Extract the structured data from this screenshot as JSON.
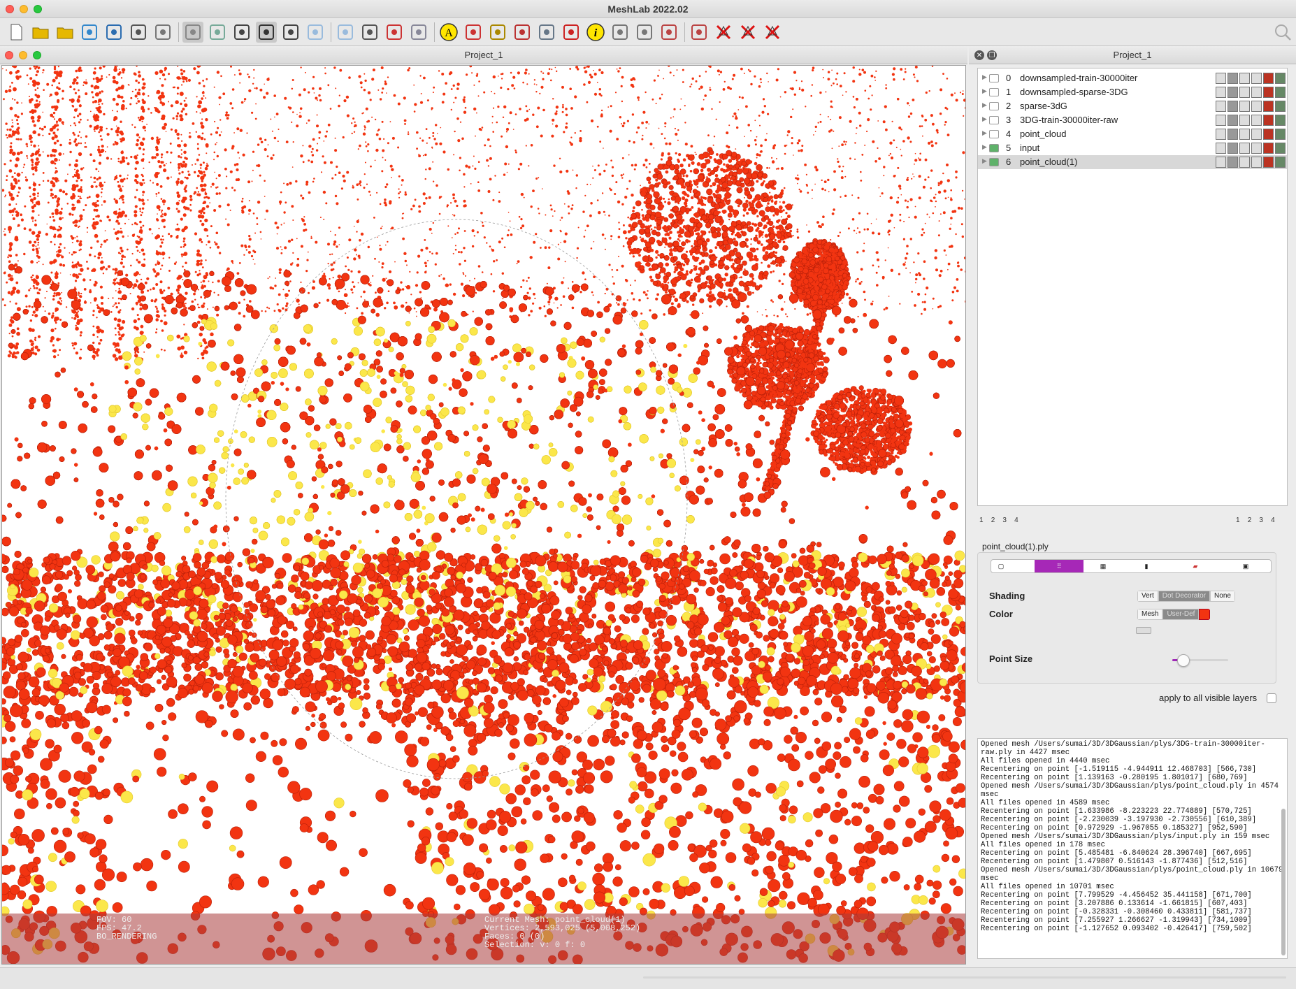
{
  "app": {
    "title": "MeshLab 2022.02"
  },
  "toolbar": {
    "icons": [
      "new-project",
      "open-project",
      "open-mesh",
      "reload",
      "reload-all",
      "save",
      "snapshot",
      "layers",
      "show-grid",
      "bbox",
      "points",
      "wireframe",
      "flat",
      "smooth",
      "box-lines",
      "axis",
      "trackball",
      "annotation",
      "measure",
      "calc",
      "paint",
      "pick",
      "georef",
      "info",
      "select",
      "select-vert",
      "select-face",
      "select-conn",
      "delete-vert",
      "delete-face",
      "delete-selected"
    ]
  },
  "viewport": {
    "window_title": "Project_1",
    "hud_left": [
      "FOV: 60",
      "FPS:   47.2",
      "BO_RENDERING"
    ],
    "hud_right": [
      "Current Mesh: point_cloud(1)",
      "Vertices: 2,593,025     (5,008,252)",
      "Faces: 0     (0)",
      "Selection: v: 0 f: 0"
    ],
    "colors": {
      "red": "#f23411",
      "yellow": "#fbe74a",
      "background": "#ffffff"
    }
  },
  "panel": {
    "title": "Project_1",
    "layers": [
      {
        "num": "0",
        "name": "downsampled-train-30000iter",
        "visible": false
      },
      {
        "num": "1",
        "name": "downsampled-sparse-3DG",
        "visible": false
      },
      {
        "num": "2",
        "name": "sparse-3dG",
        "visible": false
      },
      {
        "num": "3",
        "name": "3DG-train-30000iter-raw",
        "visible": false
      },
      {
        "num": "4",
        "name": "point_cloud",
        "visible": false
      },
      {
        "num": "5",
        "name": "input",
        "visible": true
      },
      {
        "num": "6",
        "name": "point_cloud(1)",
        "visible": true,
        "selected": true
      }
    ],
    "pages_left": [
      "1",
      "2",
      "3",
      "4"
    ],
    "pages_right": [
      "1",
      "2",
      "3",
      "4"
    ],
    "file_label": "point_cloud(1).ply",
    "shading_label": "Shading",
    "shading_options": [
      "Vert",
      "Dot Decorator",
      "None"
    ],
    "color_label": "Color",
    "color_options": [
      "Mesh",
      "User-Def"
    ],
    "point_size_label": "Point Size",
    "point_size_value": 0.2,
    "apply_label": "apply to all visible layers"
  },
  "log": [
    "Opened mesh /Users/sumai/3D/3DGaussian/plys/3DG-train-30000iter-",
    "raw.ply in 4427 msec",
    "All files opened in 4440 msec",
    "Recentering on point [-1.519115 -4.944911 12.468703] [566,730]",
    "Recentering on point [1.139163 -0.280195 1.801017] [680,769]",
    "Opened mesh /Users/sumai/3D/3DGaussian/plys/point_cloud.ply in 4574",
    "msec",
    "All files opened in 4589 msec",
    "Recentering on point [1.633986 -8.223223 22.774889] [570,725]",
    "Recentering on point [-2.230039 -3.197930 -2.730556] [610,389]",
    "Recentering on point [0.972929 -1.967055 0.185327] [952,590]",
    "Opened mesh /Users/sumai/3D/3DGaussian/plys/input.ply in 159 msec",
    "All files opened in 178 msec",
    "Recentering on point [5.485481 -6.840624 28.396740] [667,695]",
    "Recentering on point [1.479807 0.516143 -1.877436] [512,516]",
    "Opened mesh /Users/sumai/3D/3DGaussian/plys/point_cloud.ply in 10679",
    "msec",
    "All files opened in 10701 msec",
    "Recentering on point [7.799529 -4.456452 35.441158] [671,700]",
    "Recentering on point [3.207886 0.133614 -1.661815] [607,403]",
    "Recentering on point [-0.328331 -0.308460 0.433811] [581,737]",
    "Recentering on point [7.255927 1.266627 -1.319943] [734,1009]",
    "Recentering on point [-1.127652 0.093402 -0.426417] [759,502]"
  ]
}
